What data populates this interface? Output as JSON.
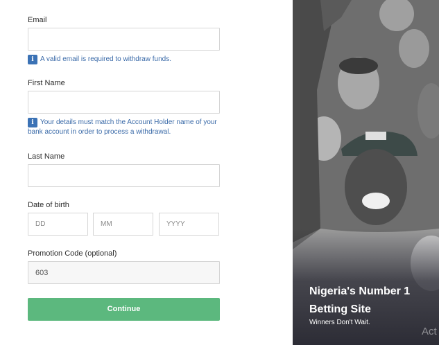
{
  "form": {
    "email_label": "Email",
    "email_value": "",
    "email_info": "A valid email is required to withdraw funds.",
    "first_name_label": "First Name",
    "first_name_value": "",
    "first_name_info": "Your details must match the Account Holder name of your bank account in order to process a withdrawal.",
    "last_name_label": "Last Name",
    "last_name_value": "",
    "dob_label": "Date of birth",
    "dob_day_placeholder": "DD",
    "dob_month_placeholder": "MM",
    "dob_year_placeholder": "YYYY",
    "promo_label": "Promotion Code (optional)",
    "promo_value": "603",
    "continue_label": "Continue",
    "info_icon_glyph": "i"
  },
  "hero": {
    "title": "Nigeria's Number 1 Betting Site",
    "subtitle": "Winners Don't Wait.",
    "watermark": "Act"
  },
  "colors": {
    "accent_green": "#5cb87e",
    "info_blue": "#3b72b5",
    "info_text": "#3a6aa8"
  },
  "icons": {
    "info": "info-icon"
  }
}
